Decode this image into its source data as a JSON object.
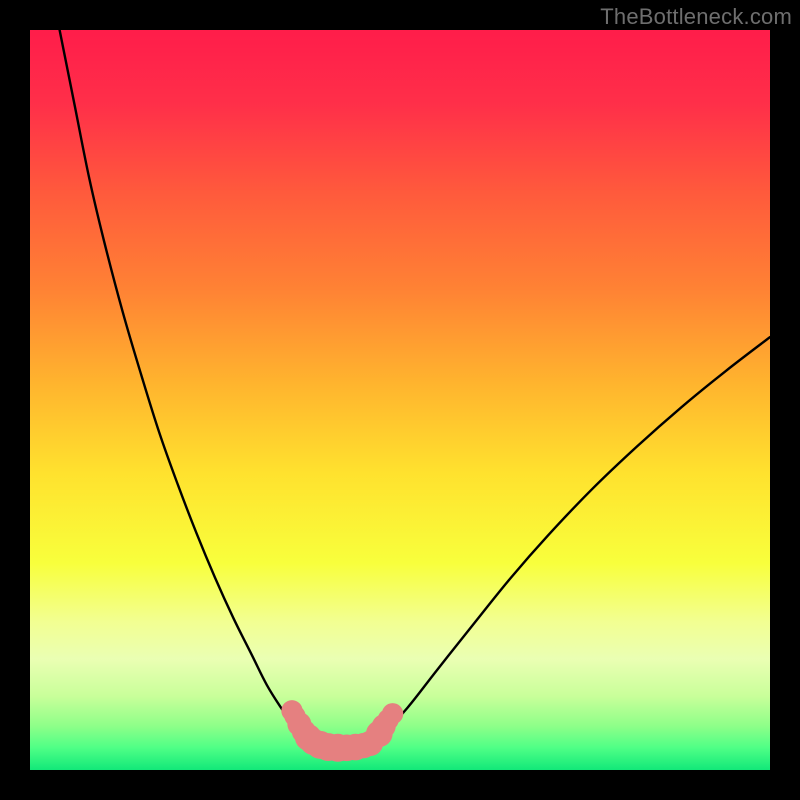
{
  "watermark": "TheBottleneck.com",
  "colors": {
    "frame": "#000000",
    "gradient_stops": [
      {
        "offset": 0.0,
        "color": "#ff1d4a"
      },
      {
        "offset": 0.1,
        "color": "#ff2f49"
      },
      {
        "offset": 0.22,
        "color": "#ff5a3c"
      },
      {
        "offset": 0.35,
        "color": "#ff8234"
      },
      {
        "offset": 0.48,
        "color": "#ffb52e"
      },
      {
        "offset": 0.6,
        "color": "#ffe22e"
      },
      {
        "offset": 0.72,
        "color": "#f8ff3c"
      },
      {
        "offset": 0.8,
        "color": "#f2ff92"
      },
      {
        "offset": 0.85,
        "color": "#eaffb3"
      },
      {
        "offset": 0.9,
        "color": "#c9ff9a"
      },
      {
        "offset": 0.94,
        "color": "#8fff89"
      },
      {
        "offset": 0.97,
        "color": "#4fff86"
      },
      {
        "offset": 1.0,
        "color": "#12e879"
      }
    ],
    "curve": "#000000",
    "marker_fill": "#e58080",
    "marker_stroke": "#b85b5b"
  },
  "chart_data": {
    "type": "line",
    "title": "",
    "xlabel": "",
    "ylabel": "",
    "xlim": [
      0,
      100
    ],
    "ylim": [
      0,
      100
    ],
    "grid": false,
    "series": [
      {
        "name": "left-curve",
        "x": [
          4.0,
          6.0,
          8.0,
          10.0,
          12.5,
          15.0,
          17.5,
          20.0,
          22.5,
          25.0,
          27.5,
          30.0,
          32.0,
          34.0,
          35.5,
          36.5,
          37.3
        ],
        "y": [
          100.0,
          90.0,
          80.0,
          71.5,
          62.0,
          53.5,
          45.5,
          38.5,
          32.0,
          26.0,
          20.5,
          15.5,
          11.5,
          8.3,
          6.2,
          4.8,
          3.9
        ]
      },
      {
        "name": "floor",
        "x": [
          37.3,
          38.5,
          40.0,
          41.5,
          43.0,
          44.5,
          46.0
        ],
        "y": [
          3.9,
          3.4,
          3.1,
          3.0,
          3.0,
          3.1,
          3.5
        ]
      },
      {
        "name": "right-curve",
        "x": [
          46.0,
          48.0,
          51.0,
          55.0,
          60.0,
          65.0,
          70.0,
          76.0,
          82.0,
          88.0,
          94.0,
          100.0
        ],
        "y": [
          3.5,
          5.2,
          8.4,
          13.5,
          19.8,
          26.0,
          31.7,
          38.0,
          43.7,
          49.0,
          53.9,
          58.5
        ]
      }
    ],
    "markers": [
      {
        "x": 35.4,
        "y": 8.0,
        "r": 1.0
      },
      {
        "x": 35.8,
        "y": 7.3,
        "r": 1.0
      },
      {
        "x": 36.4,
        "y": 6.2,
        "r": 1.2
      },
      {
        "x": 37.0,
        "y": 5.2,
        "r": 1.2
      },
      {
        "x": 37.6,
        "y": 4.4,
        "r": 1.4
      },
      {
        "x": 38.3,
        "y": 3.8,
        "r": 1.4
      },
      {
        "x": 39.2,
        "y": 3.4,
        "r": 1.5
      },
      {
        "x": 40.3,
        "y": 3.1,
        "r": 1.5
      },
      {
        "x": 41.6,
        "y": 3.0,
        "r": 1.5
      },
      {
        "x": 42.8,
        "y": 3.0,
        "r": 1.4
      },
      {
        "x": 44.0,
        "y": 3.1,
        "r": 1.4
      },
      {
        "x": 45.1,
        "y": 3.3,
        "r": 1.3
      },
      {
        "x": 46.0,
        "y": 3.6,
        "r": 1.3
      },
      {
        "x": 47.2,
        "y": 4.9,
        "r": 1.4
      },
      {
        "x": 47.8,
        "y": 5.9,
        "r": 1.2
      },
      {
        "x": 48.4,
        "y": 6.8,
        "r": 1.0
      },
      {
        "x": 49.0,
        "y": 7.6,
        "r": 1.0
      }
    ]
  }
}
